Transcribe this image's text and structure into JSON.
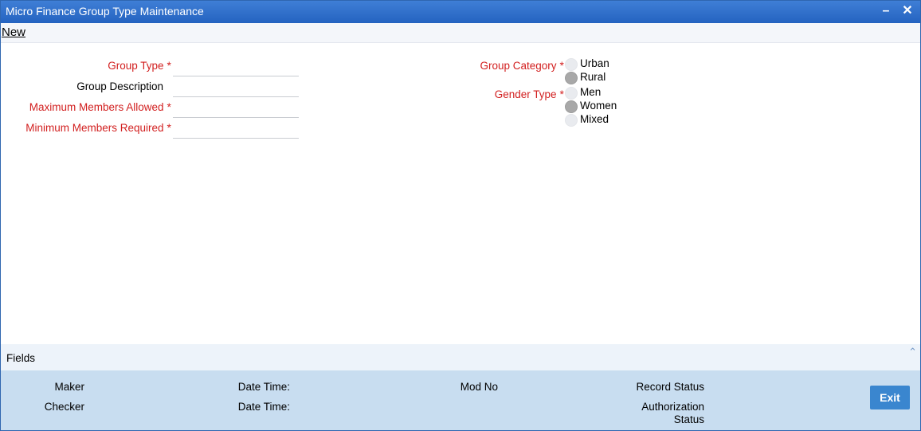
{
  "window": {
    "title": "Micro Finance Group Type Maintenance",
    "minimize_icon": "minus-icon",
    "close_icon": "x-icon"
  },
  "menu": {
    "new_label": "New"
  },
  "form": {
    "group_type": {
      "label": "Group Type",
      "required": "*",
      "value": ""
    },
    "group_description": {
      "label": "Group Description",
      "value": ""
    },
    "max_members": {
      "label": "Maximum Members Allowed",
      "required": "*",
      "value": ""
    },
    "min_members": {
      "label": "Minimum Members Required",
      "required": "*",
      "value": ""
    },
    "group_category": {
      "label": "Group Category",
      "required": "*",
      "options": [
        "Urban",
        "Rural"
      ],
      "selected": "Rural"
    },
    "gender_type": {
      "label": "Gender Type",
      "required": "*",
      "options": [
        "Men",
        "Women",
        "Mixed"
      ],
      "selected": "Women"
    }
  },
  "fields_section": {
    "label": "Fields",
    "chevron_icon": "chevron-up-icon"
  },
  "audit": {
    "maker": "Maker",
    "checker": "Checker",
    "date_time_1": "Date Time:",
    "date_time_2": "Date Time:",
    "mod_no": "Mod No",
    "record_status": "Record Status",
    "authorization_status_line1": "Authorization",
    "authorization_status_line2": "Status",
    "exit_label": "Exit"
  },
  "colors": {
    "title_bar": "#2d6cc8",
    "required": "#d21f1f",
    "audit_bg": "#c8ddf0",
    "exit_button": "#3a86cf"
  }
}
